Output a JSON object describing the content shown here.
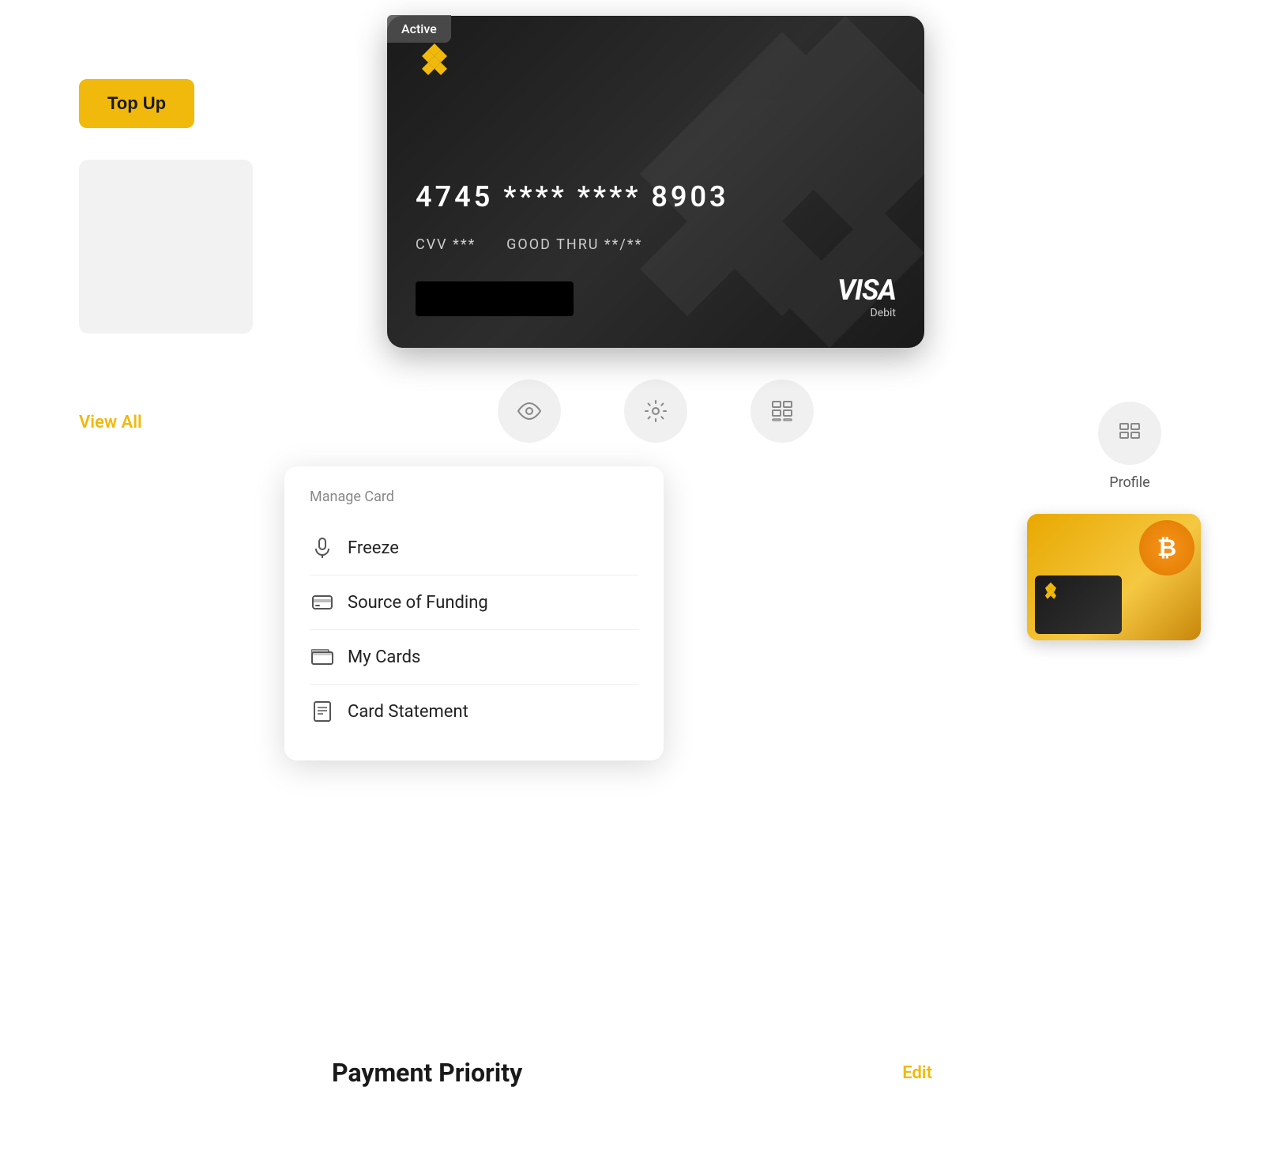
{
  "topup": {
    "label": "Top Up"
  },
  "viewall": {
    "label": "View All"
  },
  "card": {
    "active_badge": "Active",
    "number": "4745  ****  ****  8903",
    "cvv_label": "CVV ***",
    "good_thru_label": "GOOD THRU **/**",
    "visa_label": "VISA",
    "debit_label": "Debit"
  },
  "actions": [
    {
      "id": "view",
      "icon": "👁",
      "label": ""
    },
    {
      "id": "settings",
      "icon": "⚙",
      "label": ""
    },
    {
      "id": "grid",
      "icon": "⊞",
      "label": ""
    }
  ],
  "manage_card": {
    "title": "Manage Card",
    "items": [
      {
        "id": "freeze",
        "icon": "🔒",
        "label": "Freeze"
      },
      {
        "id": "funding",
        "icon": "💾",
        "label": "Source of Funding"
      },
      {
        "id": "mycards",
        "icon": "💳",
        "label": "My Cards"
      },
      {
        "id": "statement",
        "icon": "📋",
        "label": "Card Statement"
      }
    ]
  },
  "profile": {
    "label": "Profile"
  },
  "payment_priority": {
    "title": "Payment Priority",
    "edit_label": "Edit"
  }
}
